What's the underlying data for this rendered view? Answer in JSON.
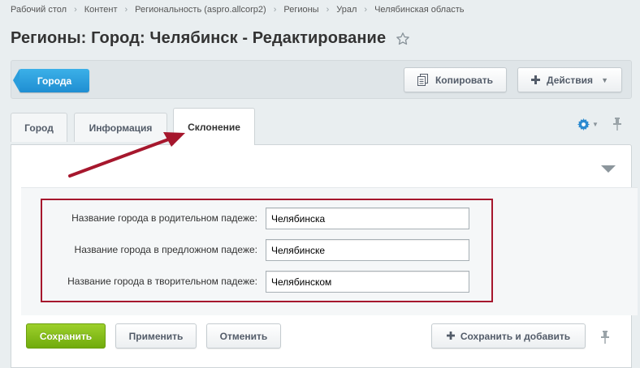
{
  "breadcrumbs": [
    "Рабочий стол",
    "Контент",
    "Региональность (aspro.allcorp2)",
    "Регионы",
    "Урал",
    "Челябинская область"
  ],
  "page_title": "Регионы: Город: Челябинск - Редактирование",
  "toolbar": {
    "back_label": "Города",
    "copy_label": "Копировать",
    "actions_label": "Действия"
  },
  "tabs": [
    {
      "label": "Город"
    },
    {
      "label": "Информация"
    },
    {
      "label": "Склонение"
    }
  ],
  "active_tab": "Склонение",
  "fields": [
    {
      "label": "Название города в родительном падеже:",
      "value": "Челябинска"
    },
    {
      "label": "Название города в предложном падеже:",
      "value": "Челябинске"
    },
    {
      "label": "Название города в творительном падеже:",
      "value": "Челябинском"
    }
  ],
  "buttons": {
    "save": "Сохранить",
    "apply": "Применить",
    "cancel": "Отменить",
    "save_and_add": "Сохранить и добавить"
  },
  "colors": {
    "accent_blue": "#1f8ed2",
    "save_green": "#70ab0c",
    "highlight_red": "#a6172d"
  },
  "icons": [
    "star-icon",
    "copy-icon",
    "plus-icon",
    "gear-icon",
    "pin-icon",
    "collapse-triangle-icon",
    "annotation-arrow"
  ]
}
